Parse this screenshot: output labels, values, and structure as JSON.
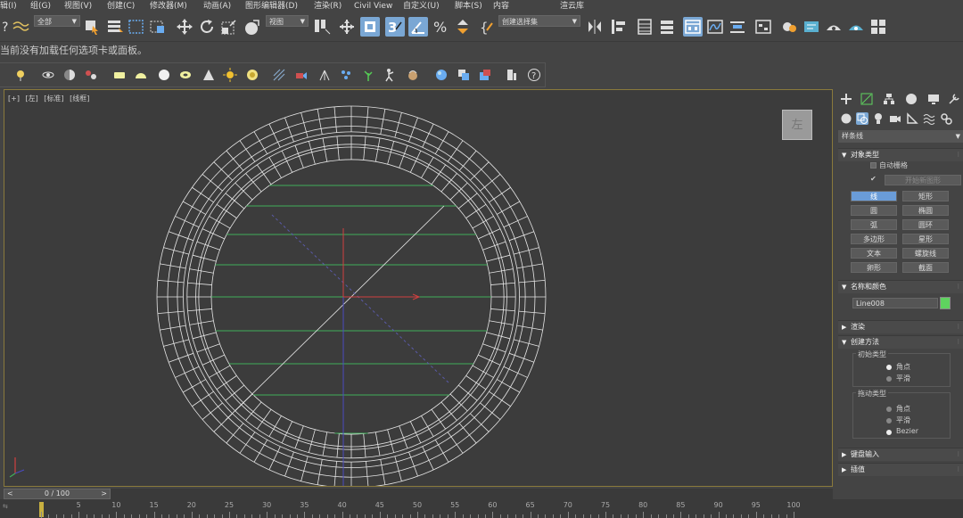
{
  "menubar": {
    "items": [
      "辑(I)",
      "组(G)",
      "视图(V)",
      "创建(C)",
      "修改器(M)",
      "动画(A)",
      "图形编辑器(D)",
      "渲染(R)",
      "Civil View",
      "自定义(U)",
      "脚本(S)",
      "内容",
      "渲云库"
    ]
  },
  "toolbar": {
    "filter_select": "全部",
    "ref_coord_select": "视图",
    "named_selection": "创建选择集"
  },
  "message": "当前没有加载任何选项卡或面板。",
  "viewport": {
    "label_parts": [
      "[+]",
      "[左]",
      "[标准]",
      "[线框]"
    ],
    "viewcube_label": "左"
  },
  "command_panel": {
    "category_select": "样条线",
    "object_type": {
      "title": "对象类型",
      "autogrid_label": "自动栅格",
      "start_new_shape": "开始新图形",
      "buttons": [
        "线",
        "矩形",
        "圆",
        "椭圆",
        "弧",
        "圆环",
        "多边形",
        "星形",
        "文本",
        "螺旋线",
        "卵形",
        "截面"
      ],
      "selected": "线"
    },
    "name_color": {
      "title": "名称和颜色",
      "name_value": "Line008",
      "swatch_color": "#5fd35f"
    },
    "rollouts": {
      "render": "渲染",
      "creation_method": "创建方法",
      "keyboard_entry": "键盘输入",
      "interpolation": "插值"
    },
    "initial_type": {
      "label": "初始类型",
      "options": [
        "角点",
        "平滑"
      ],
      "selected": "角点"
    },
    "drag_type": {
      "label": "拖动类型",
      "options": [
        "角点",
        "平滑",
        "Bezier"
      ],
      "selected": "Bezier"
    }
  },
  "timeline": {
    "frame_readout": "0 / 100",
    "left_arrow": "<",
    "right_arrow": ">",
    "ticks": [
      "5",
      "10",
      "15",
      "20",
      "25",
      "30",
      "35",
      "40",
      "45",
      "50",
      "55",
      "60",
      "65",
      "70",
      "75",
      "80",
      "85",
      "90",
      "95",
      "100"
    ]
  },
  "colors": {
    "accent": "#7aa7d4",
    "viewport_border": "#8a7a3c",
    "green_lines": "#3fae5a",
    "axis_red": "#c0393b"
  }
}
